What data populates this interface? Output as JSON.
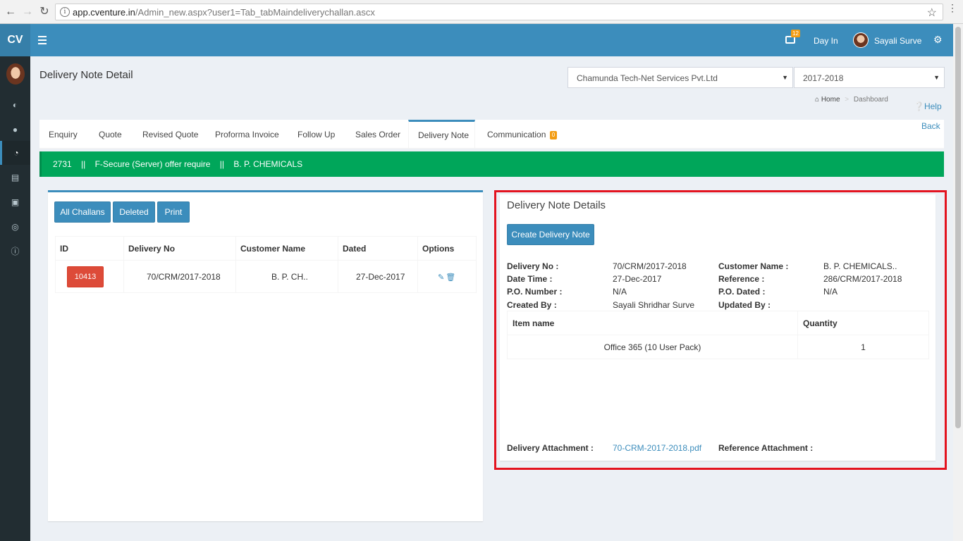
{
  "browser": {
    "url_host": "app.cventure.in",
    "url_path": "/Admin_new.aspx?user1=Tab_tabMaindeliverychallan.ascx"
  },
  "navbar": {
    "logo": "CV",
    "notification_count": "12",
    "day_in": "Day In",
    "username": "Sayali Surve"
  },
  "header": {
    "title": "Delivery Note Detail",
    "company_select": "Chamunda Tech-Net Services Pvt.Ltd",
    "year_select": "2017-2018",
    "breadcrumb_home": "Home",
    "breadcrumb_current": "Dashboard",
    "help": "Help",
    "back": "Back"
  },
  "tabs": [
    {
      "label": "Enquiry"
    },
    {
      "label": "Quote"
    },
    {
      "label": "Revised Quote"
    },
    {
      "label": "Proforma Invoice"
    },
    {
      "label": "Follow Up"
    },
    {
      "label": "Sales Order"
    },
    {
      "label": "Delivery Note"
    },
    {
      "label": "Communication",
      "count": "0"
    }
  ],
  "infobar": {
    "text": "2731    ||    F-Secure (Server) offer require    ||    B. P. CHEMICALS"
  },
  "challans": {
    "buttons": {
      "all": "All Challans",
      "deleted": "Deleted",
      "print": "Print"
    },
    "columns": [
      "ID",
      "Delivery No",
      "Customer Name",
      "Dated",
      "Options"
    ],
    "rows": [
      {
        "id": "10413",
        "delivery_no": "70/CRM/2017-2018",
        "customer": "B. P. CH..",
        "dated": "27-Dec-2017"
      }
    ]
  },
  "details": {
    "title": "Delivery Note Details",
    "create_button": "Create Delivery Note",
    "delivery_no_label": "Delivery No :",
    "delivery_no": "70/CRM/2017-2018",
    "customer_label": "Customer Name :",
    "customer": "B. P. CHEMICALS..",
    "datetime_label": "Date Time :",
    "datetime": "27-Dec-2017",
    "reference_label": "Reference :",
    "reference": "286/CRM/2017-2018",
    "po_number_label": "P.O. Number :",
    "po_number": "N/A",
    "po_dated_label": "P.O. Dated :",
    "po_dated": "N/A",
    "created_by_label": "Created By :",
    "created_by": "Sayali Shridhar Surve",
    "updated_by_label": "Updated By :",
    "items_columns": [
      "Item name",
      "Quantity"
    ],
    "items": [
      {
        "name": "Office 365 (10 User Pack)",
        "quantity": "1"
      }
    ],
    "delivery_attachment_label": "Delivery Attachment :",
    "delivery_attachment": "70-CRM-2017-2018.pdf",
    "reference_attachment_label": "Reference Attachment :"
  },
  "colors": {
    "primary": "#3c8dbc",
    "success": "#00a65a",
    "danger": "#dd4b39",
    "warning": "#f39c12",
    "sidebar": "#222d32",
    "highlight": "#e3131f"
  }
}
